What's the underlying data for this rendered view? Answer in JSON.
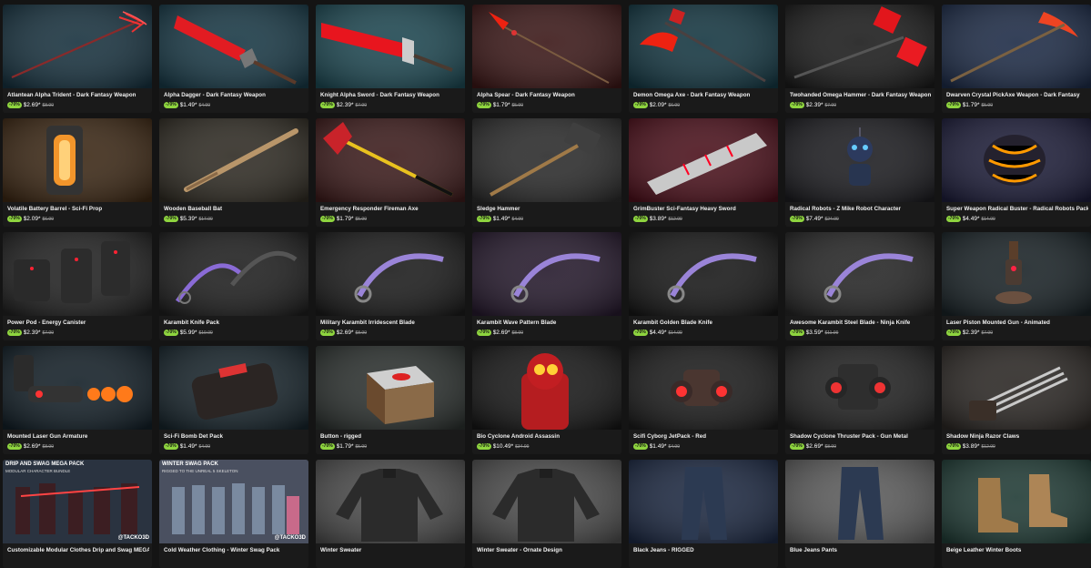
{
  "products": [
    {
      "title": "Atlantean Alpha Trident - Dark Fantasy Weapon",
      "discount": "-70%",
      "price": "$2.69*",
      "old_price": "$8.99",
      "icon": "trident-icon",
      "bg": "#16303d"
    },
    {
      "title": "Alpha Dagger - Dark Fantasy Weapon",
      "discount": "-70%",
      "price": "$1.49*",
      "old_price": "$4.99",
      "icon": "red-dagger-icon",
      "bg": "#173744"
    },
    {
      "title": "Knight Alpha Sword - Dark Fantasy Weapon",
      "discount": "-70%",
      "price": "$2.39*",
      "old_price": "$7.99",
      "icon": "red-sword-icon",
      "bg": "#1c4650"
    },
    {
      "title": "Alpha Spear - Dark Fantasy Weapon",
      "discount": "-70%",
      "price": "$1.79*",
      "old_price": "$5.99",
      "icon": "spear-icon",
      "bg": "#3a1616"
    },
    {
      "title": "Demon Omega Axe - Dark Fantasy Weapon",
      "discount": "-70%",
      "price": "$2.09*",
      "old_price": "$6.99",
      "icon": "axe-icon",
      "bg": "#133540"
    },
    {
      "title": "Twohanded Omega Hammer - Dark Fantasy Weapon",
      "discount": "-70%",
      "price": "$2.39*",
      "old_price": "$7.99",
      "icon": "hammer-icon",
      "bg": "#1a1a1a"
    },
    {
      "title": "Dwarven Crystal PickAxe Weapon - Dark Fantasy",
      "discount": "-70%",
      "price": "$1.79*",
      "old_price": "$5.99",
      "icon": "pickaxe-icon",
      "bg": "#1c2a45"
    },
    {
      "title": "Volatile Battery Barrel - Sci-Fi Prop",
      "discount": "-70%",
      "price": "$2.09*",
      "old_price": "$6.99",
      "icon": "battery-icon",
      "bg": "#3a2613"
    },
    {
      "title": "Wooden Baseball Bat",
      "discount": "-70%",
      "price": "$5.39*",
      "old_price": "$17.99",
      "icon": "baseball-bat-icon",
      "bg": "#2e2a22"
    },
    {
      "title": "Emergency Responder Fireman Axe",
      "discount": "-70%",
      "price": "$1.79*",
      "old_price": "$5.99",
      "icon": "fire-axe-icon",
      "bg": "#3b1a1a"
    },
    {
      "title": "Sledge Hammer",
      "discount": "-70%",
      "price": "$1.49*",
      "old_price": "$4.99",
      "icon": "sledge-hammer-icon",
      "bg": "#2a2a2a"
    },
    {
      "title": "GrimBuster Sci-Fantasy Heavy Sword",
      "discount": "-70%",
      "price": "$3.89*",
      "old_price": "$12.99",
      "icon": "heavy-sword-icon",
      "bg": "#4a0f1a"
    },
    {
      "title": "Radical Robots - Z Mike Robot Character",
      "discount": "-70%",
      "price": "$7.49*",
      "old_price": "$24.99",
      "icon": "robot-icon",
      "bg": "#1b1b1f"
    },
    {
      "title": "Super Weapon Radical Buster - Radical Robots Pack",
      "discount": "-70%",
      "price": "$4.49*",
      "old_price": "$14.99",
      "icon": "buster-icon",
      "bg": "#1c1c38"
    },
    {
      "title": "Power Pod - Energy Canister",
      "discount": "-70%",
      "price": "$2.39*",
      "old_price": "$7.99",
      "icon": "canister-icon",
      "bg": "#202020"
    },
    {
      "title": "Karambit Knife Pack",
      "discount": "-70%",
      "price": "$5.99*",
      "old_price": "$19.99",
      "icon": "karambit-pack-icon",
      "bg": "#1d1d1d"
    },
    {
      "title": "Military Karambit Irridescent Blade",
      "discount": "-70%",
      "price": "$2.69*",
      "old_price": "$8.99",
      "icon": "karambit-icon",
      "bg": "#1a1a1a"
    },
    {
      "title": "Karambit Wave Pattern Blade",
      "discount": "-70%",
      "price": "$2.69*",
      "old_price": "$8.99",
      "icon": "karambit-icon",
      "bg": "#24182b"
    },
    {
      "title": "Karambit Golden Blade Knife",
      "discount": "-70%",
      "price": "$4.49*",
      "old_price": "$14.99",
      "icon": "karambit-icon",
      "bg": "#161616"
    },
    {
      "title": "Awesome Karambit Steel Blade - Ninja Knife",
      "discount": "-70%",
      "price": "$3.59*",
      "old_price": "$11.99",
      "icon": "karambit-icon",
      "bg": "#242424"
    },
    {
      "title": "Laser Piston Mounted Gun - Animated",
      "discount": "-70%",
      "price": "$2.39*",
      "old_price": "$7.99",
      "icon": "laser-piston-icon",
      "bg": "#182125"
    },
    {
      "title": "Mounted Laser Gun Armature",
      "discount": "-70%",
      "price": "$2.69*",
      "old_price": "$8.99",
      "icon": "laser-gun-icon",
      "bg": "#121e26"
    },
    {
      "title": "Sci-Fi Bomb Det Pack",
      "discount": "-70%",
      "price": "$1.49*",
      "old_price": "$4.99",
      "icon": "bomb-icon",
      "bg": "#16232a"
    },
    {
      "title": "Button - rigged",
      "discount": "-70%",
      "price": "$1.79*",
      "old_price": "$5.99",
      "icon": "button-box-icon",
      "bg": "#2a2f2d"
    },
    {
      "title": "Bio Cyclone Android Assassin",
      "discount": "-70%",
      "price": "$10.49*",
      "old_price": "$34.99",
      "icon": "android-icon",
      "bg": "#161616"
    },
    {
      "title": "Scifi Cyborg JetPack - Red",
      "discount": "-70%",
      "price": "$1.49*",
      "old_price": "$4.99",
      "icon": "jetpack-icon",
      "bg": "#1a1a1a"
    },
    {
      "title": "Shadow Cyclone Thruster Pack - Gun Metal",
      "discount": "-70%",
      "price": "$2.69*",
      "old_price": "$8.99",
      "icon": "thruster-icon",
      "bg": "#202020"
    },
    {
      "title": "Shadow Ninja Razor Claws",
      "discount": "-70%",
      "price": "$3.89*",
      "old_price": "$12.99",
      "icon": "claws-icon",
      "bg": "#2a2623"
    },
    {
      "title": "Customizable Modular Clothes Drip and Swag MEGA Pa...",
      "discount": "",
      "price": "",
      "old_price": "",
      "icon": "mega-pack-icon",
      "bg": "#2a3340",
      "banner": "DRIP AND SWAG MEGA PACK",
      "banner_sub": "MODULAR CHARACTER BUNDLE",
      "brand": "@TACKO3D"
    },
    {
      "title": "Cold Weather Clothing - Winter Swag Pack",
      "discount": "",
      "price": "",
      "old_price": "",
      "icon": "winter-pack-icon",
      "bg": "#3b4250",
      "banner": "WINTER SWAG PACK",
      "banner_sub": "RIGGED TO THE UNREAL 5 SKELETON",
      "brand": "@TACKO3D"
    },
    {
      "title": "Winter Sweater",
      "discount": "",
      "price": "",
      "old_price": "",
      "icon": "sweater-icon",
      "bg": "#4a4a4a"
    },
    {
      "title": "Winter Sweater - Ornate Design",
      "discount": "",
      "price": "",
      "old_price": "",
      "icon": "sweater-icon",
      "bg": "#4b4b4b"
    },
    {
      "title": "Black Jeans - RIGGED",
      "discount": "",
      "price": "",
      "old_price": "",
      "icon": "jeans-icon",
      "bg": "#1b2740"
    },
    {
      "title": "Blue Jeans Pants",
      "discount": "",
      "price": "",
      "old_price": "",
      "icon": "jeans-icon",
      "bg": "#5a5a5a"
    },
    {
      "title": "Beige Leather Winter Boots",
      "discount": "",
      "price": "",
      "old_price": "",
      "icon": "boots-icon",
      "bg": "#1f3a34"
    }
  ]
}
